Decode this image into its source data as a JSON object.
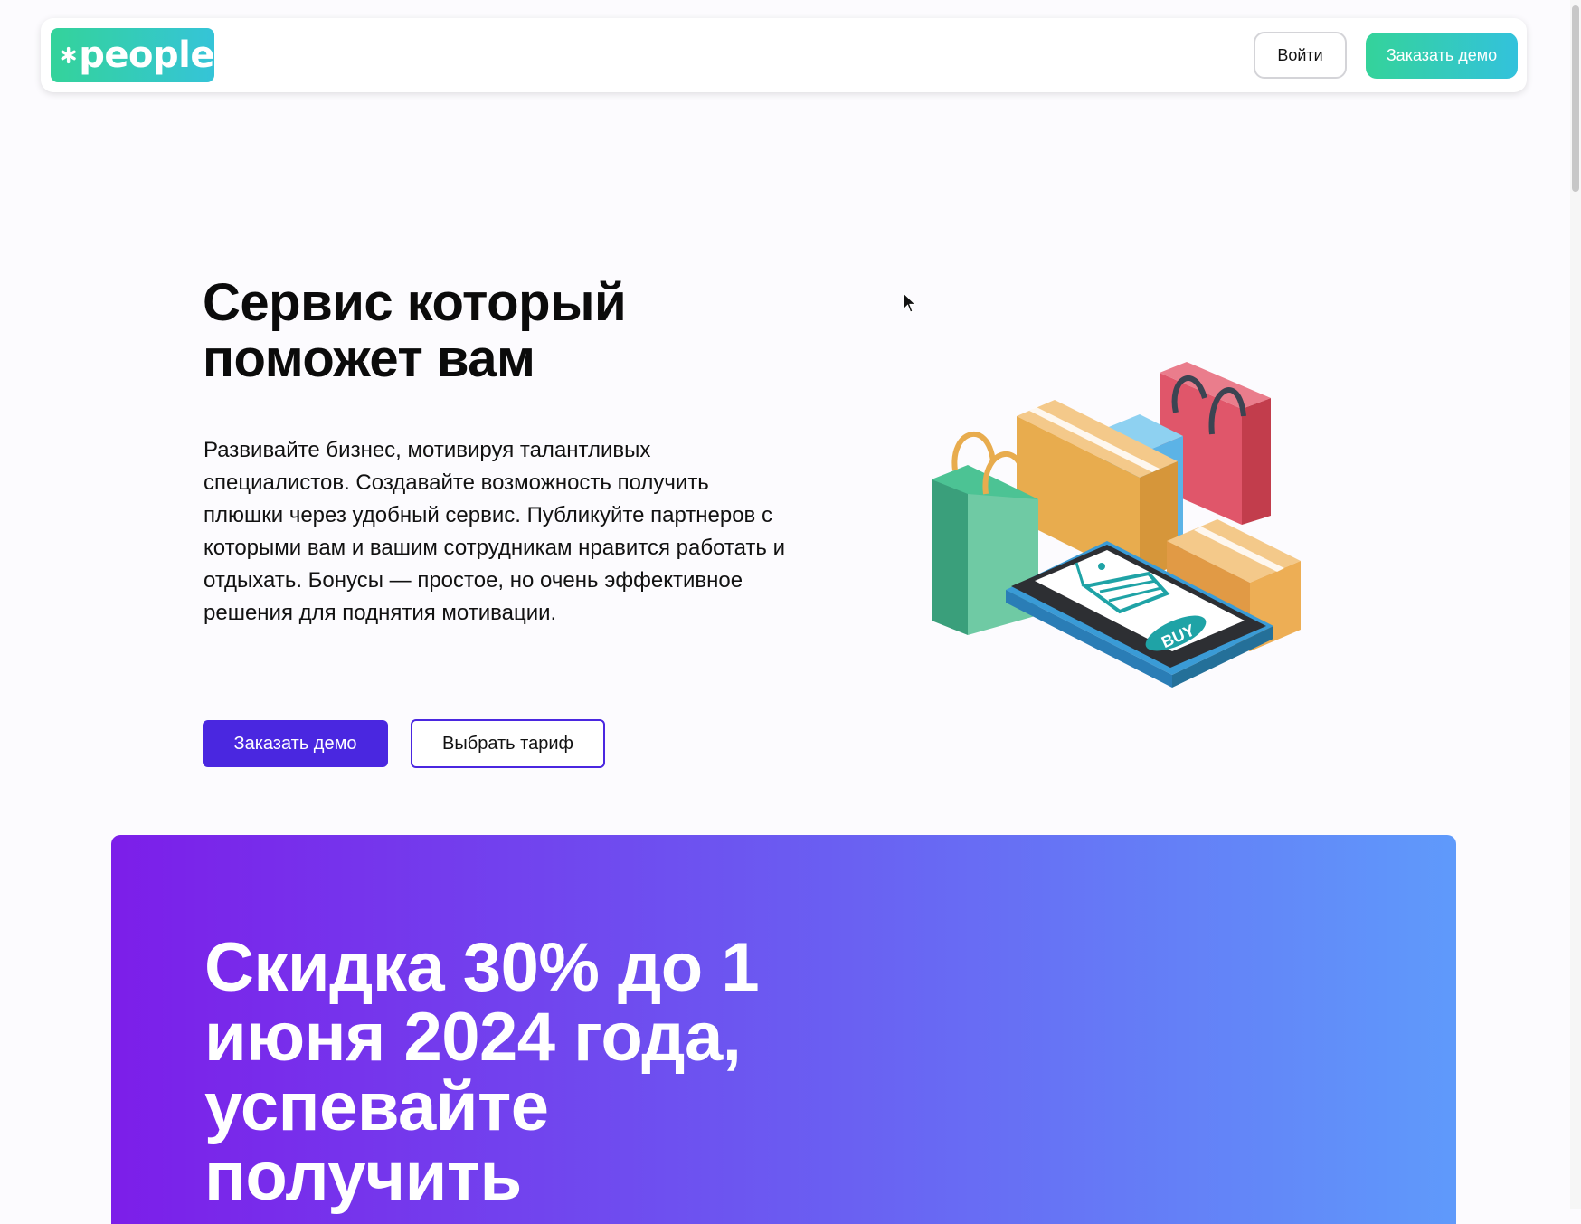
{
  "header": {
    "logo_text": "people",
    "login_label": "Войти",
    "demo_label": "Заказать демо",
    "colors": {
      "logo_gradient_start": "#34d39a",
      "logo_gradient_end": "#35c4d8"
    }
  },
  "hero": {
    "title": "Сервис который поможет вам",
    "description": "Развивайте бизнес, мотивируя талантливых специалистов. Создавайте возможность получить плюшки через удобный сервис. Публикуйте партнеров с которыми вам и вашим сотрудникам нравится работать и отдыхать. Бонусы — простое, но очень эффективное решения для поднятия мотивации.",
    "primary_button": "Заказать демо",
    "secondary_button": "Выбрать тариф",
    "illustration_badge": "BUY",
    "accent_color": "#4a27e0"
  },
  "promo": {
    "title": "Скидка 30% до 1 июня 2024 года, успевайте получить",
    "gradient": [
      "#7c1ee9",
      "#6b5af1",
      "#5f9afb"
    ]
  },
  "icons": {
    "logo": "asterisk-icon",
    "illustration": "shopping-illustration",
    "cursor": "mouse-cursor-icon"
  }
}
